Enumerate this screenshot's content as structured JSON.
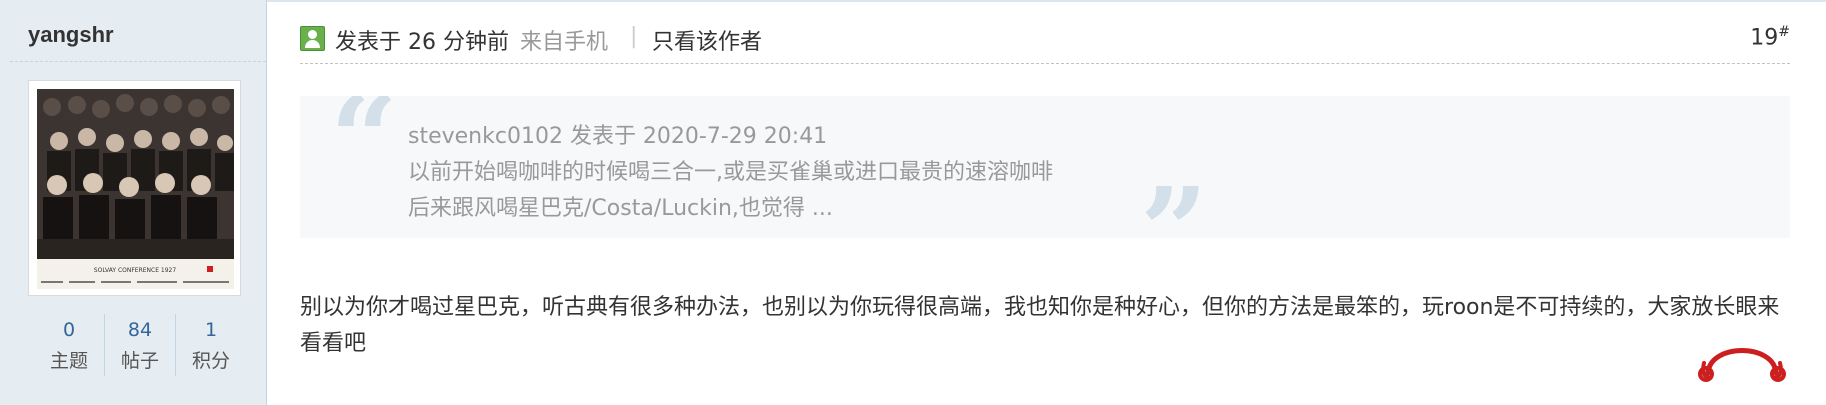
{
  "author": {
    "username": "yangshr",
    "avatar_caption": "SOLVAY CONFERENCE 1927",
    "stats": [
      {
        "value": "0",
        "label": "主题"
      },
      {
        "value": "84",
        "label": "帖子"
      },
      {
        "value": "1",
        "label": "积分"
      }
    ]
  },
  "post": {
    "icon": "author-online-icon",
    "time_text": "发表于 26 分钟前",
    "source_text": "来自手机",
    "separator": "|",
    "only_author_label": "只看该作者",
    "floor_number": "19",
    "floor_mark": "#",
    "quote": {
      "open_mark": "“",
      "close_mark": "”",
      "header": "stevenkc0102 发表于 2020-7-29 20:41",
      "line1": "以前开始喝咖啡的时候喝三合一,或是买雀巢或进口最贵的速溶咖啡",
      "line2": "后来跟风喝星巴克/Costa/Luckin,也觉得 ..."
    },
    "body": "别以为你才喝过星巴克，听古典有很多种办法，也别以为你玩得很高端，我也知你是种好心，但你的方法是最笨的，玩roon是不可持续的，大家放长眼来看看吧"
  },
  "colors": {
    "sidebar_bg": "#e5edf2",
    "stat_number": "#336699",
    "quote_bg": "#f6f8fa",
    "quote_text": "#999999",
    "brand_red": "#cc1f1f"
  },
  "icons": [
    "author-online-icon",
    "headphone-icon",
    "quote-open-icon",
    "quote-close-icon"
  ]
}
